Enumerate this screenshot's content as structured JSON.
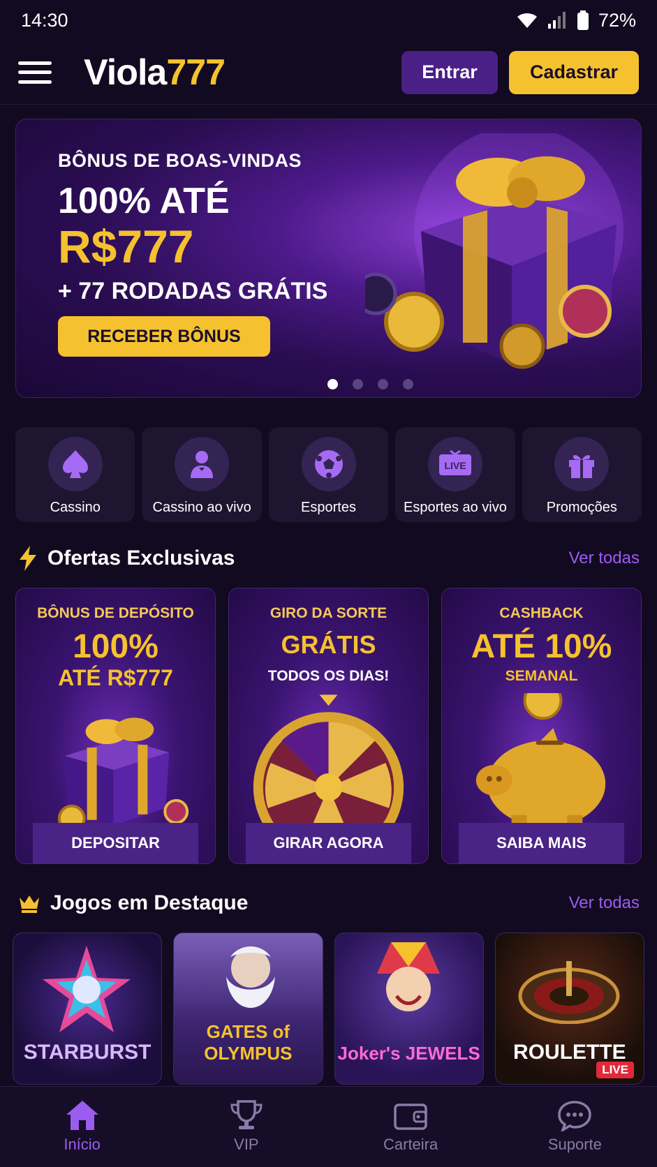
{
  "status": {
    "time": "14:30",
    "battery": "72%"
  },
  "header": {
    "logo_a": "Viola",
    "logo_b": "777",
    "login": "Entrar",
    "register": "Cadastrar"
  },
  "hero": {
    "kicker": "BÔNUS DE BOAS-VINDAS",
    "line1": "100% ATÉ",
    "line2": "R$777",
    "line3": "+ 77 RODADAS GRÁTIS",
    "cta": "RECEBER BÔNUS",
    "slides": 4,
    "active_slide": 1
  },
  "categories": [
    {
      "label": "Cassino",
      "icon": "spade-icon"
    },
    {
      "label": "Cassino ao vivo",
      "icon": "dealer-icon"
    },
    {
      "label": "Esportes",
      "icon": "soccer-ball-icon"
    },
    {
      "label": "Esportes ao vivo",
      "icon": "live-tv-icon",
      "icon_text": "LIVE"
    },
    {
      "label": "Promoções",
      "icon": "gift-icon"
    }
  ],
  "offers_section": {
    "title": "Ofertas Exclusivas",
    "link": "Ver todas",
    "icon": "lightning-icon"
  },
  "offers": [
    {
      "kicker": "BÔNUS DE DEPÓSITO",
      "big": "100%",
      "sub": "ATÉ R$777",
      "button": "DEPOSITAR",
      "art": "gift-box"
    },
    {
      "kicker": "GIRO DA SORTE",
      "big": "GRÁTIS",
      "sub": "TODOS OS DIAS!",
      "button": "GIRAR AGORA",
      "art": "prize-wheel"
    },
    {
      "kicker": "CASHBACK",
      "big": "ATÉ 10%",
      "sub": "SEMANAL",
      "button": "SAIBA MAIS",
      "art": "piggy-bank"
    }
  ],
  "games_section": {
    "title": "Jogos em Destaque",
    "link": "Ver todas",
    "icon": "crown-icon"
  },
  "games": [
    {
      "title": "STARBURST"
    },
    {
      "title": "GATES of OLYMPUS"
    },
    {
      "title": "Joker's JEWELS"
    },
    {
      "title": "ROULETTE",
      "badge": "LIVE"
    }
  ],
  "nav": [
    {
      "label": "Início",
      "icon": "home-icon",
      "active": true
    },
    {
      "label": "VIP",
      "icon": "trophy-icon",
      "active": false
    },
    {
      "label": "Carteira",
      "icon": "wallet-icon",
      "active": false
    },
    {
      "label": "Suporte",
      "icon": "chat-icon",
      "active": false
    }
  ],
  "colors": {
    "accent": "#f5c12e",
    "primary": "#4a1f86",
    "link": "#9b5cf0",
    "background": "#120a20"
  }
}
